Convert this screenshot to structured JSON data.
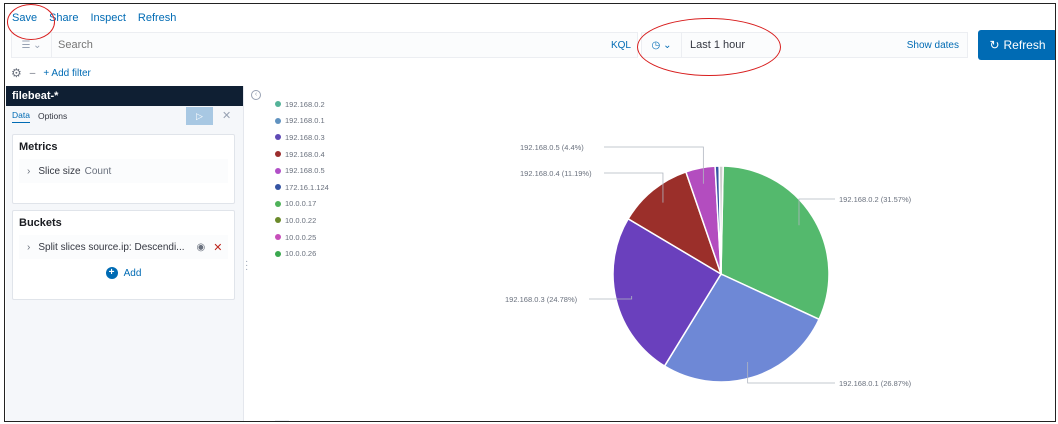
{
  "toolbar": {
    "save": "Save",
    "share": "Share",
    "inspect": "Inspect",
    "refresh": "Refresh"
  },
  "query": {
    "placeholder": "Search",
    "language": "KQL",
    "date_range": "Last 1 hour",
    "show_dates": "Show dates",
    "refresh_button": "Refresh"
  },
  "filters": {
    "add_filter": "+ Add filter"
  },
  "editor": {
    "index_pattern": "filebeat-*",
    "tabs": {
      "data": "Data",
      "options": "Options"
    },
    "metrics": {
      "title": "Metrics",
      "item_label": "Slice size",
      "item_value": "Count"
    },
    "buckets": {
      "title": "Buckets",
      "item_label": "Split slices source.ip: Descendi..."
    },
    "add_label": "Add"
  },
  "chart_data": {
    "type": "pie",
    "title": "",
    "legend_position": "top-left",
    "legend": [
      {
        "label": "192.168.0.2",
        "color": "#54b399"
      },
      {
        "label": "192.168.0.1",
        "color": "#6092c0"
      },
      {
        "label": "192.168.0.3",
        "color": "#5f4ab5"
      },
      {
        "label": "192.168.0.4",
        "color": "#9b2d2d"
      },
      {
        "label": "192.168.0.5",
        "color": "#b14fc7"
      },
      {
        "label": "172.16.1.124",
        "color": "#3554a3"
      },
      {
        "label": "10.0.0.17",
        "color": "#4fb25a"
      },
      {
        "label": "10.0.0.22",
        "color": "#6b8a2a"
      },
      {
        "label": "10.0.0.25",
        "color": "#c74fba"
      },
      {
        "label": "10.0.0.26",
        "color": "#3aa84f"
      }
    ],
    "slices": [
      {
        "label": "192.168.0.2 (31.57%)",
        "ip": "192.168.0.2",
        "value": 31.57,
        "color": "#54b96d"
      },
      {
        "label": "192.168.0.1 (26.87%)",
        "ip": "192.168.0.1",
        "value": 26.87,
        "color": "#6e88d6"
      },
      {
        "label": "192.168.0.3 (24.78%)",
        "ip": "192.168.0.3",
        "value": 24.78,
        "color": "#6a40bd"
      },
      {
        "label": "192.168.0.4 (11.19%)",
        "ip": "192.168.0.4",
        "value": 11.19,
        "color": "#9b2f2a"
      },
      {
        "label": "192.168.0.5 (4.4%)",
        "ip": "192.168.0.5",
        "value": 4.4,
        "color": "#b34dbf"
      },
      {
        "label": "",
        "ip": "172.16.1.124",
        "value": 0.6,
        "color": "#3554a3"
      },
      {
        "label": "",
        "ip": "10.0.0.17",
        "value": 0.59,
        "color": "#cfcfcf"
      }
    ]
  },
  "colors": {
    "accent": "#006bb4",
    "annotation": "#d81e1e",
    "header": "#0f1f33"
  }
}
